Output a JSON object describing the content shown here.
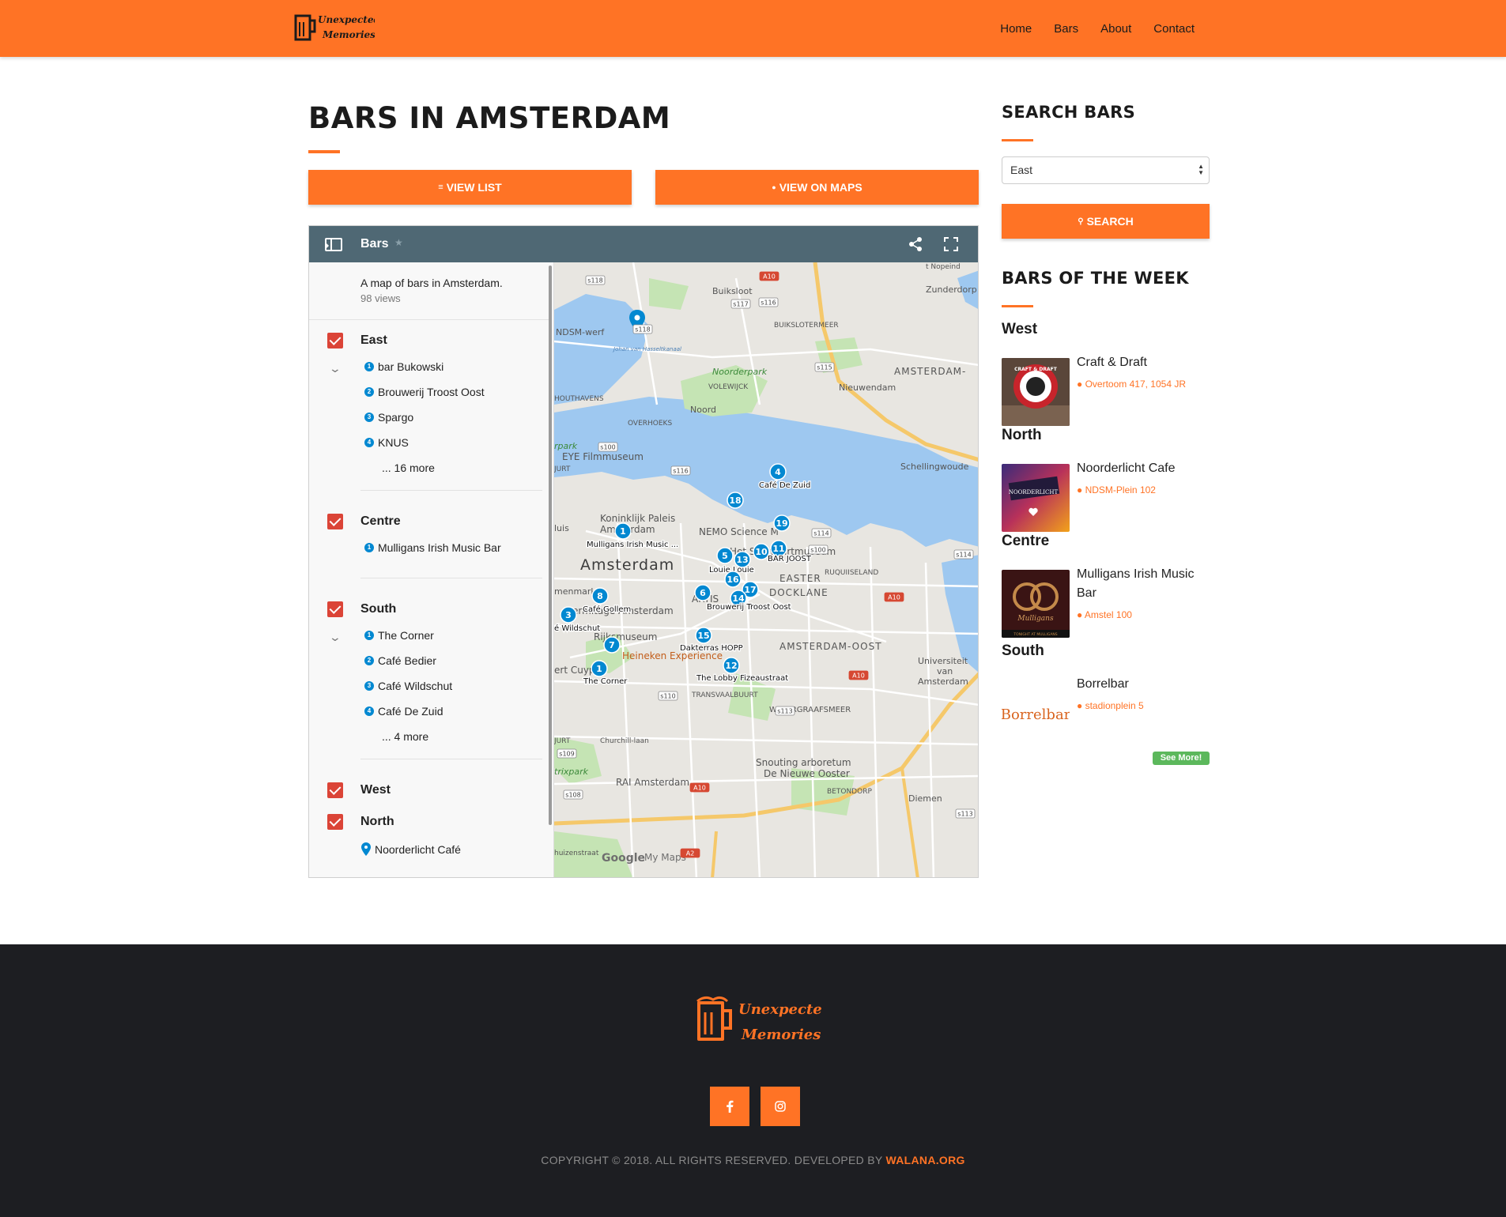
{
  "brand": {
    "logo_line1": "Unexpected",
    "logo_line2": "Memories",
    "accent": "#ff7325",
    "dark": "#1d1e22"
  },
  "nav": {
    "items": [
      "Home",
      "Bars",
      "About",
      "Contact"
    ]
  },
  "page": {
    "title": "BARS IN AMSTERDAM",
    "view_list_label": "VIEW LIST",
    "view_maps_label": "VIEW ON MAPS"
  },
  "map": {
    "title": "Bars",
    "description": "A map of bars in Amsterdam.",
    "views": "98 views",
    "layers": [
      {
        "name": "East",
        "places": [
          "bar Bukowski",
          "Brouwerij Troost Oost",
          "Spargo",
          "KNUS"
        ],
        "more": "... 16 more"
      },
      {
        "name": "Centre",
        "places": [
          "Mulligans Irish Music Bar"
        ]
      },
      {
        "name": "South",
        "places": [
          "The Corner",
          "Café Bedier",
          "Café Wildschut",
          "Café De Zuid"
        ],
        "more": "... 4 more"
      },
      {
        "name": "West",
        "places": []
      },
      {
        "name": "North",
        "places": [
          "Noorderlicht Café"
        ]
      }
    ],
    "labels": {
      "amsterdam": "Amsterdam",
      "ndsm": "NDSM-werf",
      "buiksloot": "Buiksloot",
      "buikslotermeer": "BUIKSLOTERMEER",
      "noorderpark": "Noorderpark",
      "volewijck": "VOLEWIJCK",
      "nieuwendam": "Nieuwendam",
      "amsterdam_noord": "AMSTERDAM-",
      "zunderdorp": "Zunderdorp",
      "noord": "Noord",
      "overhoeks": "OVERHOEKS",
      "houthavens": "HOUTHAVENS",
      "eye": "EYE Filmmuseum",
      "schellingwoude": "Schellingwoude",
      "paleis1": "Koninklijk Paleis",
      "paleis2": "Amsterdam",
      "nemo": "NEMO Science M",
      "scheepvaart": "Het Sch   vaartmuseum",
      "eastern": "EASTER",
      "docklands": "DOCKLANE",
      "artis": "ARTIS",
      "hermitage": "Hermitage Amsterdam",
      "rijksmuseum": "Rijksmuseum",
      "heineken": "Heineken Experience",
      "amsterdam_oost": "AMSTERDAM-OOST",
      "transvaal": "TRANSVAALBUURT",
      "watergraafsmeer": "WATERGRAAFSMEER",
      "universiteit1": "Universiteit",
      "universiteit2": "van",
      "universiteit3": "Amsterdam",
      "rai": "RAI Amsterdam",
      "betondorp": "BETONDORP",
      "diemen": "Diemen",
      "arboretum": "Snouting arboretum",
      "nieuwe_ooster": "De Nieuwe Ooster",
      "indischebuurt": "RUQUIISELAND",
      "google": "Google",
      "mymaps": "My Maps",
      "cuypmarkt": "ert Cuypm",
      "menmarkt": "menmarkt",
      "churchill": "Churchill-laan",
      "trixpark": "trixpark",
      "luis": "luis",
      "rpark": "rpark",
      "jurt": "JURT",
      "jurt2": "JURT",
      "huizenstraat": "huizenstraat",
      "noopend": "t Nopeind",
      "hasselt": "Johan van Hasseltkanaal"
    },
    "markers": [
      {
        "n": "4",
        "label": "Café De Zuid"
      },
      {
        "n": "18",
        "label": ""
      },
      {
        "n": "19",
        "label": ""
      },
      {
        "n": "1",
        "label": "Mulligans Irish Music ..."
      },
      {
        "n": "5",
        "label": ""
      },
      {
        "n": "13",
        "label": "Louie Louie"
      },
      {
        "n": "10",
        "label": ""
      },
      {
        "n": "11",
        "label": "BAR JOOST"
      },
      {
        "n": "16",
        "label": ""
      },
      {
        "n": "17",
        "label": ""
      },
      {
        "n": "6",
        "label": ""
      },
      {
        "n": "14",
        "label": "Brouwerij Troost Oost"
      },
      {
        "n": "8",
        "label": "Café Gollem"
      },
      {
        "n": "3",
        "label": "é Wildschut"
      },
      {
        "n": "15",
        "label": "Dakterras HOPP"
      },
      {
        "n": "7",
        "label": ""
      },
      {
        "n": "12",
        "label": "The Lobby Fizeaustraat"
      },
      {
        "n": "1",
        "label": "The Corner"
      }
    ],
    "road_shields": [
      "S118",
      "S118",
      "S117",
      "S116",
      "A10",
      "S115",
      "S100",
      "S116",
      "S114",
      "S100",
      "S114",
      "A10",
      "S110",
      "S113",
      "S109",
      "A10",
      "S108",
      "A10",
      "A2",
      "S113"
    ]
  },
  "sidebar": {
    "search_heading": "SEARCH BARS",
    "select_value": "East",
    "search_button": "SEARCH",
    "week_heading": "BARS OF THE WEEK",
    "see_more": "See More!",
    "bars": [
      {
        "region": "West",
        "name": "Craft & Draft",
        "address": "Overtoom 417, 1054 JR"
      },
      {
        "region": "North",
        "name": "Noorderlicht Cafe",
        "address": "NDSM-Plein 102"
      },
      {
        "region": "Centre",
        "name": "Mulligans Irish Music Bar",
        "address": "Amstel 100"
      },
      {
        "region": "South",
        "name": "Borrelbar",
        "address": "stadionplein 5"
      }
    ],
    "thumb_text": {
      "craft": "CRAFT & DRAFT",
      "mulligans": "Mulligans",
      "mulligans_sub": "TONIGHT AT MULLIGANS",
      "borrelbar": "Borrelbar",
      "noorderlicht": "NOORDERLICHT"
    }
  },
  "footer": {
    "copyright": "COPYRIGHT © 2018. ALL RIGHTS RESERVED. DEVELOPED BY ",
    "org": "WALANA.ORG",
    "social": [
      "facebook-icon",
      "instagram-icon"
    ]
  }
}
